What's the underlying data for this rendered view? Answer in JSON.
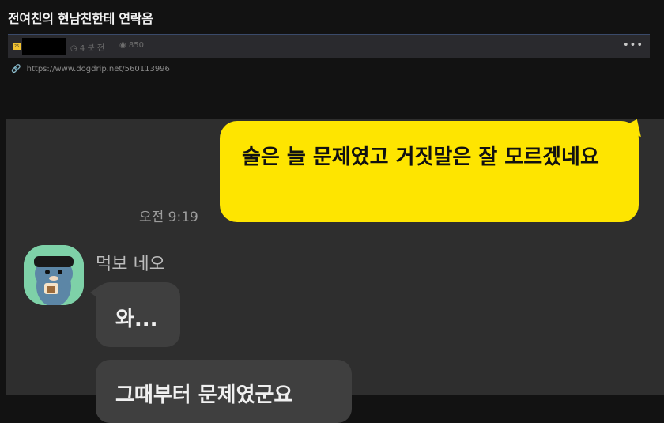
{
  "post": {
    "title": "전여친의 현남친한테 연락옴",
    "badge": "25",
    "time": "4 분 전",
    "views": "850",
    "link": "https://www.dogdrip.net/560113996"
  },
  "chat": {
    "me_message": "술은 늘 문제였고 거짓말은 잘 모르겠네요",
    "me_time": "오전 9:19",
    "sender_name": "먹보 네오",
    "other_messages": [
      "와...",
      "그때부터 문제였군요"
    ]
  },
  "colors": {
    "me_bubble": "#fee500",
    "other_bubble": "#3f3f3f",
    "chat_bg": "#2e2e2e",
    "avatar_bg": "#7ed1a8"
  }
}
